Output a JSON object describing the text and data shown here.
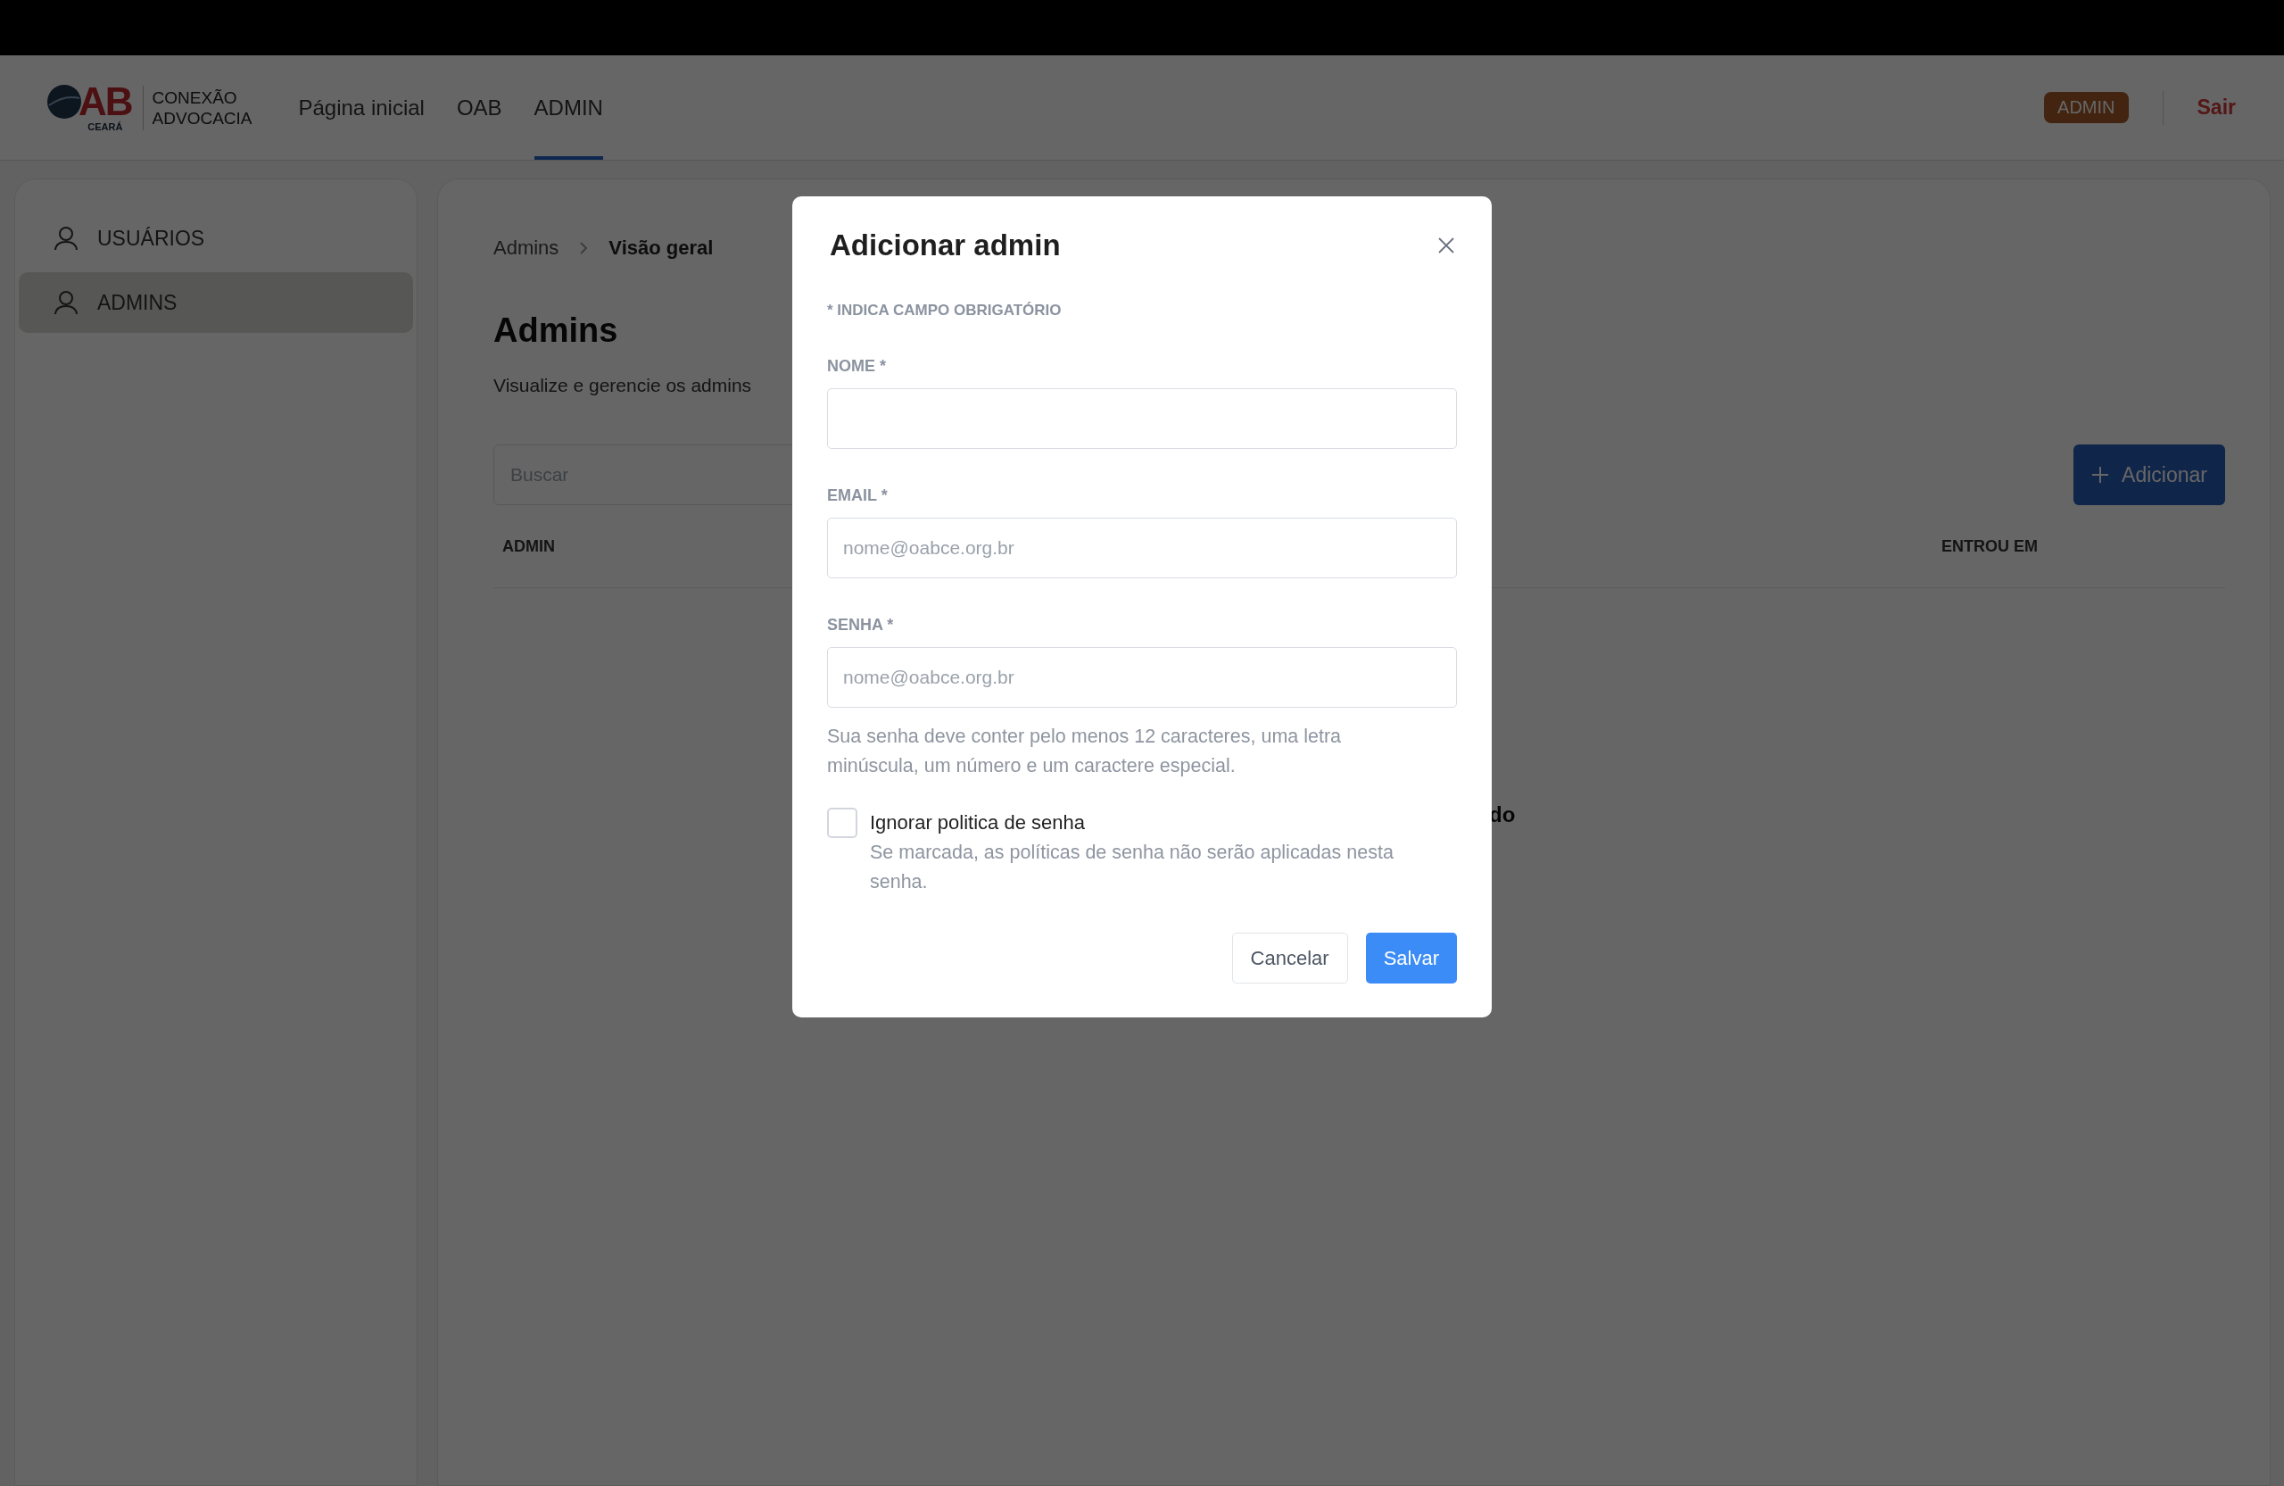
{
  "header": {
    "logo": {
      "letters": "AB",
      "caption": "CEARÁ"
    },
    "brand_lines": [
      "CONEXÃO",
      "ADVOCACIA"
    ],
    "nav": [
      {
        "label": "Página inicial",
        "selected": false
      },
      {
        "label": "OAB",
        "selected": false
      },
      {
        "label": "ADMIN",
        "selected": true
      }
    ],
    "role_badge": "ADMIN",
    "logout": "Sair"
  },
  "sidebar": {
    "items": [
      {
        "label": "USUÁRIOS",
        "selected": false
      },
      {
        "label": "ADMINS",
        "selected": true
      }
    ]
  },
  "main": {
    "breadcrumb": [
      "Admins",
      "Visão geral"
    ],
    "title": "Admins",
    "subtitle": "Visualize e gerencie os admins",
    "search": {
      "placeholder": "Buscar"
    },
    "add_button": "Adicionar",
    "table": {
      "columns": [
        "ADMIN",
        "ENTROU EM"
      ]
    },
    "empty_state": "do"
  },
  "modal": {
    "title": "Adicionar admin",
    "required_note": "* INDICA CAMPO OBRIGATÓRIO",
    "fields": [
      {
        "label": "NOME *"
      },
      {
        "label": "EMAIL *",
        "placeholder": "nome@oabce.org.br"
      },
      {
        "label": "SENHA *",
        "placeholder": "nome@oabce.org.br",
        "help": "Sua senha deve conter pelo menos 12 caracteres, uma letra minúscula, um número e um caractere especial."
      }
    ],
    "checkbox": {
      "label": "Ignorar politica de senha",
      "description": "Se marcada, as políticas de senha não serão aplicadas nesta senha.",
      "checked": false
    },
    "buttons": [
      {
        "label": "Cancelar",
        "kind": "secondary"
      },
      {
        "label": "Salvar",
        "kind": "primary"
      }
    ]
  }
}
